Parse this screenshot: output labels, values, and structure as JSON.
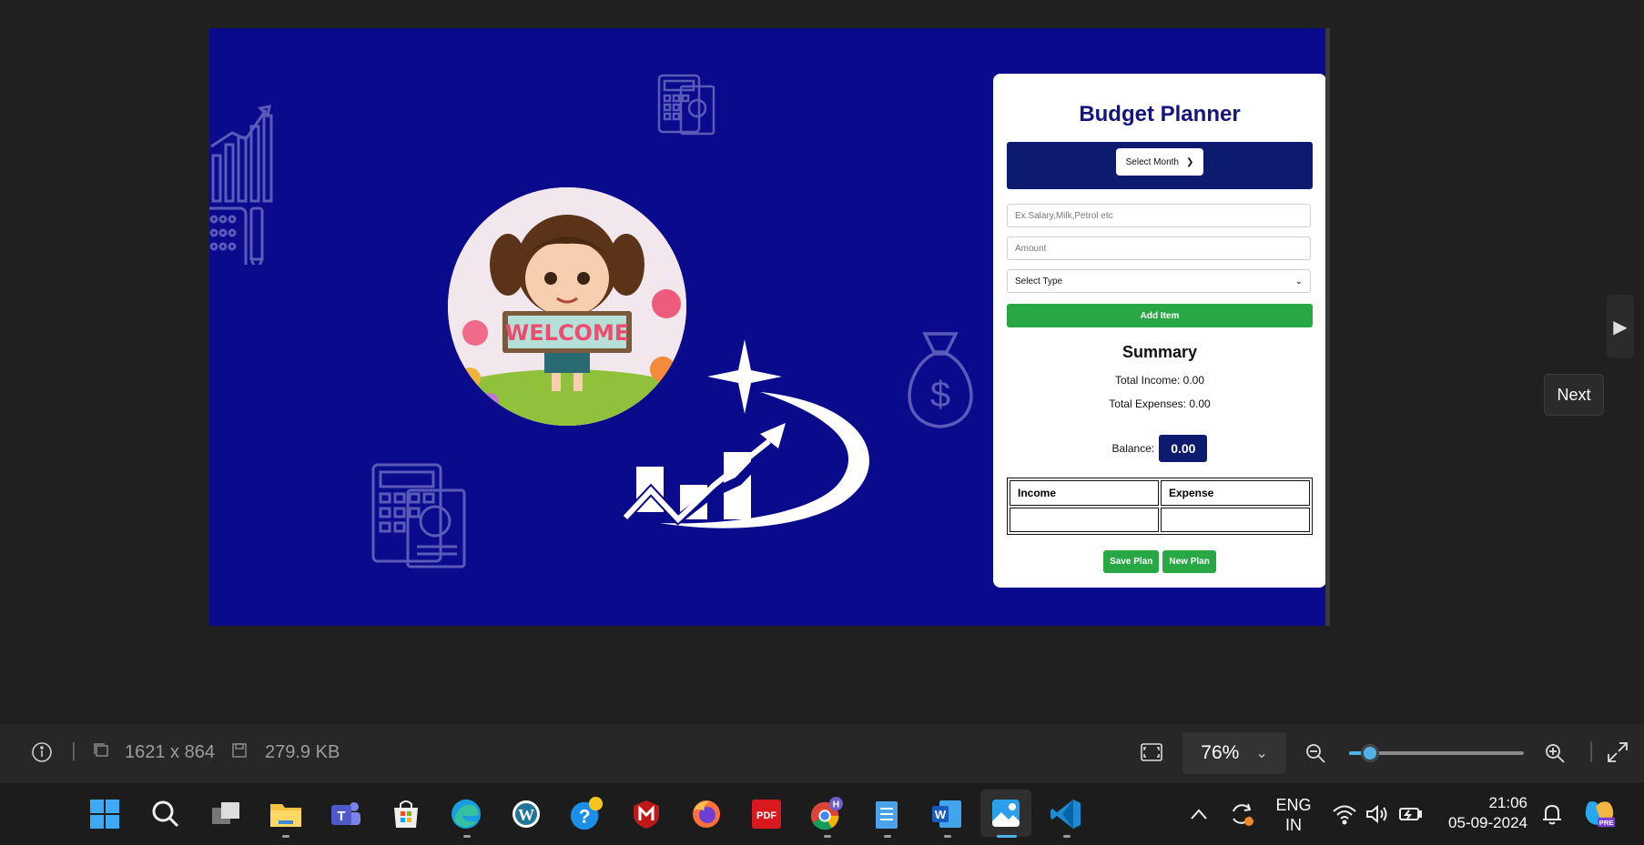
{
  "planner": {
    "title": "Budget Planner",
    "month_select": "Select Month",
    "description_placeholder": "Ex.Salary,Milk,Petrol etc",
    "amount_placeholder": "Amount",
    "type_select": "Select Type",
    "add_button": "Add Item",
    "summary_title": "Summary",
    "total_income": "Total Income: 0.00",
    "total_expenses": "Total Expenses: 0.00",
    "balance_label": "Balance:",
    "balance_value": "0.00",
    "table_headers": [
      "Income",
      "Expense"
    ],
    "save_button": "Save Plan",
    "new_button": "New Plan"
  },
  "welcome_sign": "WELCOME",
  "viewer": {
    "next_tooltip": "Next",
    "dimensions": "1621 x 864",
    "file_size": "279.9 KB",
    "zoom": "76%",
    "zoom_level": 0.12
  },
  "taskbar": {
    "apps": [
      "start-icon",
      "search-icon",
      "task-view-icon",
      "file-explorer-icon",
      "teams-icon",
      "microsoft-store-icon",
      "edge-icon",
      "wordpress-icon",
      "get-help-icon",
      "mcafee-icon",
      "firefox-icon",
      "pdf-reader-icon",
      "chrome-icon",
      "notepad-icon",
      "word-icon",
      "photos-icon",
      "vscode-icon"
    ],
    "chrome_badge": "H",
    "language_top": "ENG",
    "language_bottom": "IN",
    "time": "21:06",
    "date": "05-09-2024"
  },
  "colors": {
    "image_background": "#0a0a8c",
    "navy": "#0d1b6e",
    "green": "#28a745",
    "accent": "#4fb3ea"
  }
}
